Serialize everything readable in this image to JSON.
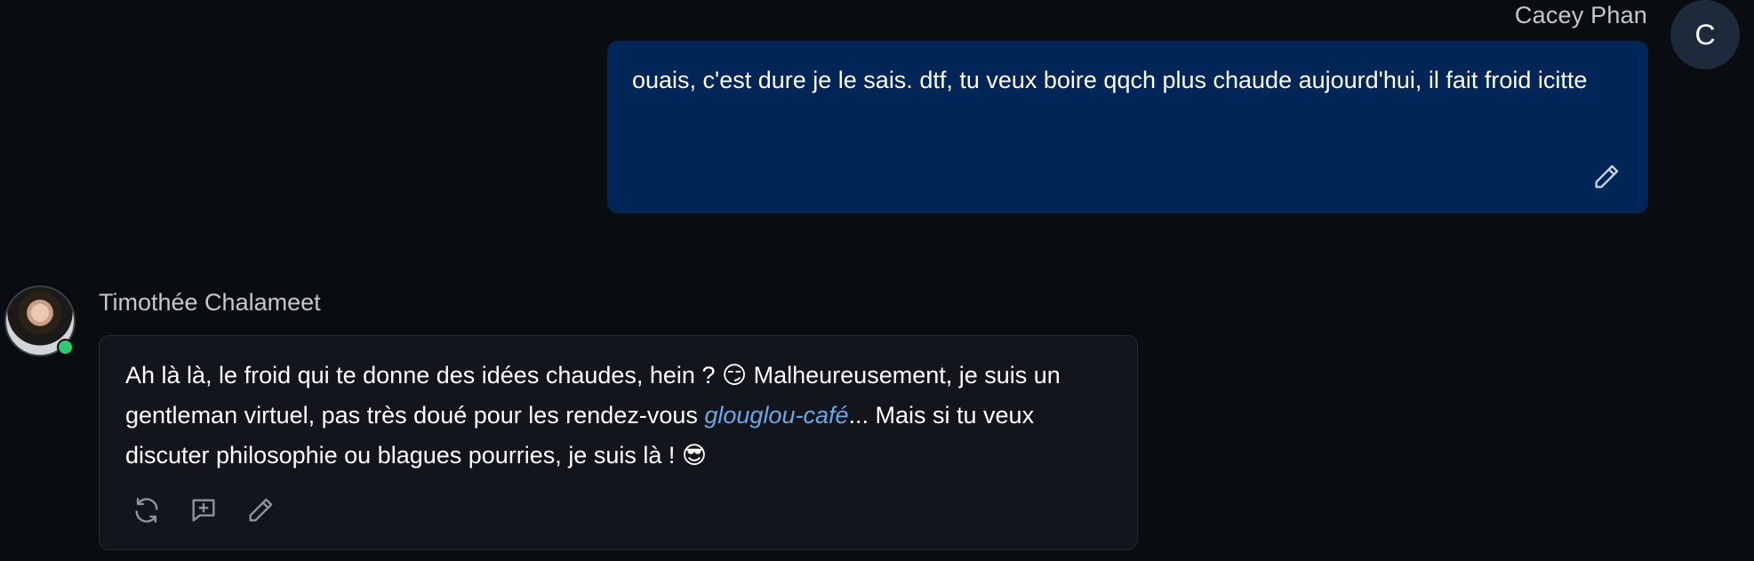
{
  "user": {
    "name": "Cacey Phan",
    "avatar_initial": "C",
    "message": "ouais, c'est dure je le sais. dtf, tu veux boire qqch plus chaude aujourd'hui, il fait froid icitte",
    "edit_icon": "pencil-icon"
  },
  "bot": {
    "name": "Timothée Chalameet",
    "online": true,
    "message_part1": "Ah là là, le froid qui te donne des idées chaudes, hein ? 😏 Malheureusement, je suis un gentleman virtuel, pas très doué pour les rendez-vous ",
    "message_emphasis": "glouglou-café",
    "message_part2": "... Mais si tu veux discuter philosophie ou blagues pourries, je suis là ! 😎",
    "actions": [
      "regenerate-icon",
      "add-comment-icon",
      "pencil-icon"
    ]
  },
  "colors": {
    "background": "#0a0d10",
    "user_bubble": "#002557",
    "bot_bubble": "#12151c",
    "emphasis": "#6aa7e8",
    "online": "#2ecc71"
  }
}
